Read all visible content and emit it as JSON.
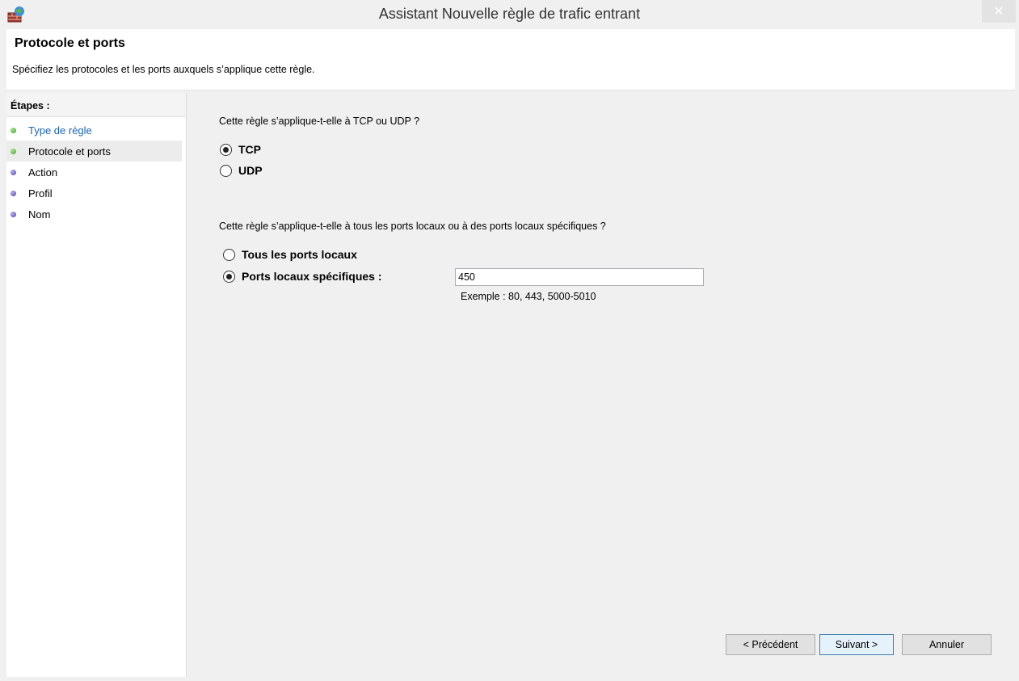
{
  "window": {
    "title": "Assistant Nouvelle règle de trafic entrant",
    "close_symbol": "✕"
  },
  "header": {
    "title": "Protocole et ports",
    "description": "Spécifiez les protocoles et les ports auxquels s’applique cette règle."
  },
  "sidebar": {
    "heading": "Étapes :",
    "steps": [
      {
        "label": "Type de règle",
        "status": "done"
      },
      {
        "label": "Protocole et ports",
        "status": "current"
      },
      {
        "label": "Action",
        "status": "todo"
      },
      {
        "label": "Profil",
        "status": "todo"
      },
      {
        "label": "Nom",
        "status": "todo"
      }
    ]
  },
  "protocol": {
    "question": "Cette règle s’applique-t-elle à TCP ou UDP ?",
    "options": [
      {
        "label": "TCP",
        "selected": true
      },
      {
        "label": "UDP",
        "selected": false
      }
    ]
  },
  "ports": {
    "question": "Cette règle s’applique-t-elle à tous les ports locaux ou à des ports locaux spécifiques ?",
    "options": [
      {
        "label": "Tous les ports locaux",
        "selected": false
      },
      {
        "label": "Ports locaux spécifiques :",
        "selected": true
      }
    ],
    "value": "450",
    "example": "Exemple : 80, 443, 5000-5010"
  },
  "buttons": {
    "previous": "< Précédent",
    "next": "Suivant >",
    "cancel": "Annuler"
  },
  "colors": {
    "link": "#1a64b8",
    "done_dot": "#3aa226",
    "todo_dot": "#4a3fb8",
    "default_button_border": "#3c7fb1"
  }
}
